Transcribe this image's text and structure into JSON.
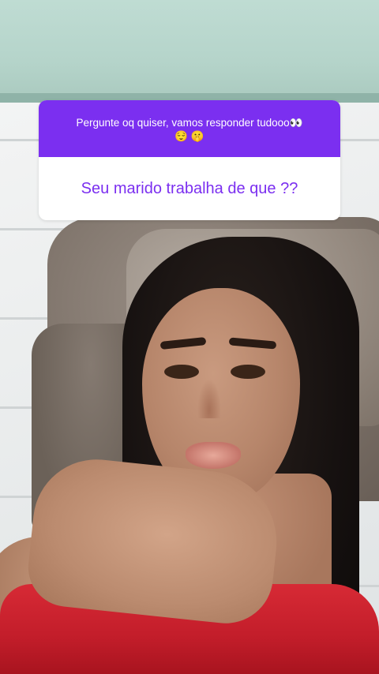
{
  "question_sticker": {
    "prompt": "Pergunte oq quiser, vamos responder tudooo👀",
    "prompt_emojis": "😌 🤫",
    "question": "Seu marido trabalha de que ??",
    "accent_color": "#7b2ff0",
    "body_color": "#ffffff"
  },
  "background": {
    "description_icon": "photo-selfie"
  }
}
